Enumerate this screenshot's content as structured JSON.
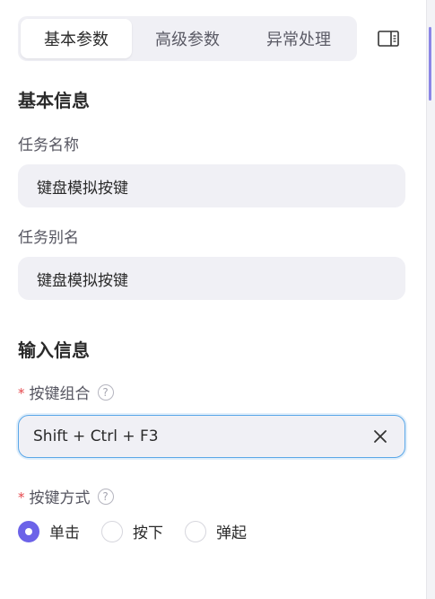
{
  "tabs": [
    {
      "label": "基本参数",
      "active": true
    },
    {
      "label": "高级参数",
      "active": false
    },
    {
      "label": "异常处理",
      "active": false
    }
  ],
  "basic_section": {
    "title": "基本信息",
    "task_name_label": "任务名称",
    "task_name_value": "键盘模拟按键",
    "task_alias_label": "任务别名",
    "task_alias_value": "键盘模拟按键"
  },
  "input_section": {
    "title": "输入信息",
    "key_combo_label": "按键组合",
    "key_combo_value": "Shift + Ctrl + F3",
    "key_mode_label": "按键方式",
    "required_mark": "*",
    "help_glyph": "?",
    "key_mode_options": [
      {
        "label": "单击",
        "checked": true
      },
      {
        "label": "按下",
        "checked": false
      },
      {
        "label": "弹起",
        "checked": false
      }
    ]
  },
  "colors": {
    "accent": "#6c63e8",
    "focus_border": "#5aa7e8",
    "required": "#e5484d",
    "field_bg": "#f0f0f5"
  },
  "icons": {
    "panel_toggle": "sidebar-panel-icon",
    "clear": "close-icon",
    "help": "question-circle-icon"
  }
}
